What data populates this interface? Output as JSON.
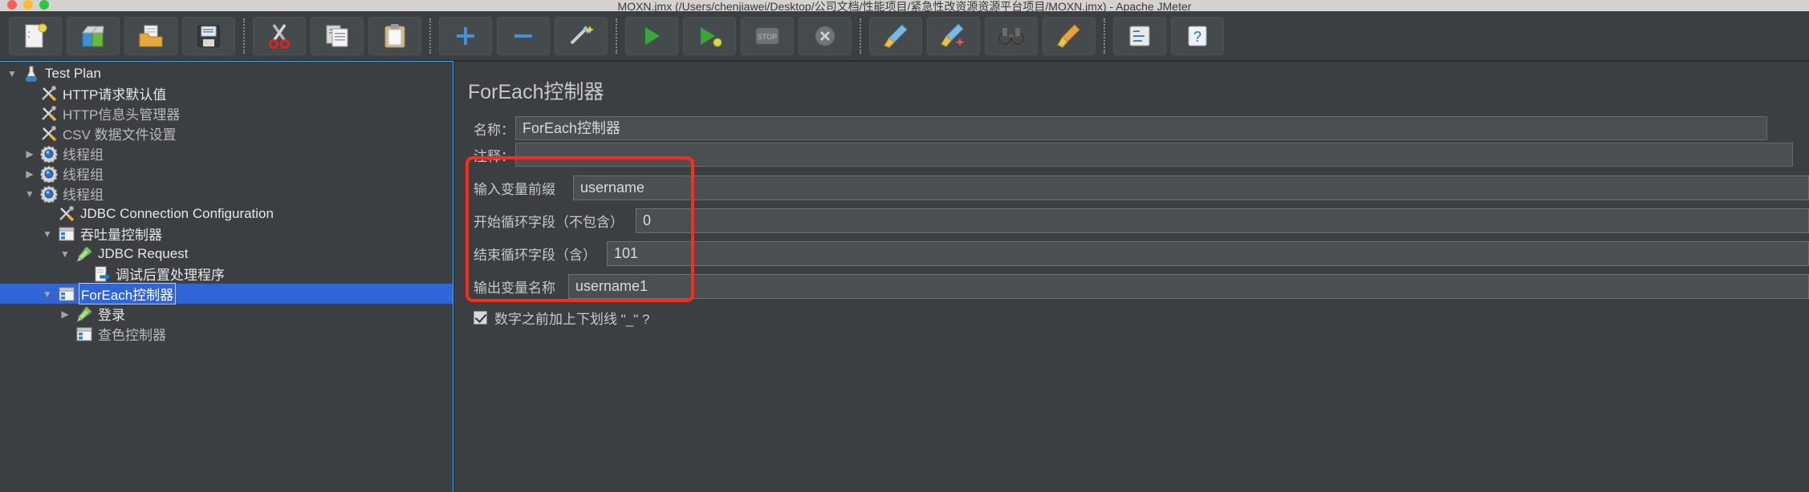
{
  "window": {
    "title": "MOXN.jmx (/Users/chenjiawei/Desktop/公司文档/性能项目/紧急性改资源资源平台项目/MOXN.jmx) - Apache JMeter",
    "traffic_lights": [
      "close",
      "minimize",
      "zoom"
    ]
  },
  "toolbar": {
    "buttons": [
      {
        "name": "new",
        "icon": "new-document-icon",
        "glyph": "📄"
      },
      {
        "name": "templates",
        "icon": "templates-icon",
        "glyph": "📚"
      },
      {
        "name": "open",
        "icon": "open-folder-icon",
        "glyph": "📂"
      },
      {
        "name": "save",
        "icon": "save-disk-icon",
        "glyph": "💾"
      },
      {
        "name": "separator-1",
        "icon": "separator",
        "glyph": ""
      },
      {
        "name": "cut",
        "icon": "scissors-icon",
        "glyph": "✂"
      },
      {
        "name": "copy",
        "icon": "copy-icon",
        "glyph": "📋"
      },
      {
        "name": "paste",
        "icon": "clipboard-icon",
        "glyph": "📋"
      },
      {
        "name": "separator-2",
        "icon": "separator",
        "glyph": ""
      },
      {
        "name": "expand-all",
        "icon": "plus-icon",
        "glyph": "+"
      },
      {
        "name": "collapse-all",
        "icon": "minus-icon",
        "glyph": "−"
      },
      {
        "name": "toggle",
        "icon": "toggle-wand-icon",
        "glyph": "✦"
      },
      {
        "name": "separator-3",
        "icon": "separator",
        "glyph": ""
      },
      {
        "name": "start",
        "icon": "play-icon",
        "glyph": "▶"
      },
      {
        "name": "start-no-pauses",
        "icon": "play-no-pause-icon",
        "glyph": "▶"
      },
      {
        "name": "stop",
        "icon": "stop-icon",
        "glyph": "STOP"
      },
      {
        "name": "shutdown",
        "icon": "shutdown-icon",
        "glyph": "✖"
      },
      {
        "name": "separator-4",
        "icon": "separator",
        "glyph": ""
      },
      {
        "name": "clear",
        "icon": "clear-broom-icon",
        "glyph": "🧹"
      },
      {
        "name": "clear-all",
        "icon": "clear-all-broom-icon",
        "glyph": "🧹"
      },
      {
        "name": "search",
        "icon": "binoculars-icon",
        "glyph": "🔍"
      },
      {
        "name": "reset-search",
        "icon": "reset-search-broom-icon",
        "glyph": "🧹"
      },
      {
        "name": "separator-5",
        "icon": "separator",
        "glyph": ""
      },
      {
        "name": "function-helper",
        "icon": "function-helper-icon",
        "glyph": "≡"
      },
      {
        "name": "help",
        "icon": "help-question-icon",
        "glyph": "?"
      }
    ]
  },
  "tree": {
    "nodes": [
      {
        "label": "Test Plan",
        "indent": 0,
        "twisty": "▼",
        "icon": "flask-icon",
        "dim": false
      },
      {
        "label": "HTTP请求默认值",
        "indent": 1,
        "twisty": "",
        "icon": "config-tools-icon",
        "dim": false
      },
      {
        "label": "HTTP信息头管理器",
        "indent": 1,
        "twisty": "",
        "icon": "config-tools-icon",
        "dim": true
      },
      {
        "label": "CSV 数据文件设置",
        "indent": 1,
        "twisty": "",
        "icon": "config-tools-icon",
        "dim": true
      },
      {
        "label": "线程组",
        "indent": 1,
        "twisty": "▶",
        "icon": "thread-group-icon",
        "dim": true
      },
      {
        "label": "线程组",
        "indent": 1,
        "twisty": "▶",
        "icon": "thread-group-icon",
        "dim": true
      },
      {
        "label": "线程组",
        "indent": 1,
        "twisty": "▼",
        "icon": "thread-group-icon",
        "dim": true
      },
      {
        "label": "JDBC Connection Configuration",
        "indent": 2,
        "twisty": "",
        "icon": "config-tools-icon",
        "dim": false
      },
      {
        "label": "吞吐量控制器",
        "indent": 2,
        "twisty": "▼",
        "icon": "controller-icon",
        "dim": false
      },
      {
        "label": "JDBC Request",
        "indent": 3,
        "twisty": "▼",
        "icon": "sampler-pipette-icon",
        "dim": false
      },
      {
        "label": "调试后置处理程序",
        "indent": 4,
        "twisty": "",
        "icon": "postprocessor-icon",
        "dim": false
      },
      {
        "label": "ForEach控制器",
        "indent": 2,
        "twisty": "▼",
        "icon": "controller-icon",
        "dim": false,
        "selected": true
      },
      {
        "label": "登录",
        "indent": 3,
        "twisty": "▶",
        "icon": "sampler-pipette-icon",
        "dim": false
      },
      {
        "label": "查色控制器",
        "indent": 3,
        "twisty": "",
        "icon": "controller-icon",
        "dim": true
      }
    ]
  },
  "editor": {
    "title": "ForEach控制器",
    "name_label": "名称：",
    "name_value": "ForEach控制器",
    "comment_label": "注释：",
    "comment_value": "",
    "params": [
      {
        "label": "输入变量前缀",
        "value": "username"
      },
      {
        "label": "开始循环字段（不包含）",
        "value": "0"
      },
      {
        "label": "结束循环字段（含）",
        "value": "101"
      },
      {
        "label": "输出变量名称",
        "value": "username1"
      }
    ],
    "checkbox": {
      "label": "数字之前加上下划线 \"_\" ?",
      "checked": true
    }
  },
  "colors": {
    "accent_selection": "#2f65d4",
    "highlight_box": "#fc2b1a",
    "panel_bg": "#3c3f41",
    "field_bg": "#4b4f51",
    "titlebar_bg": "#d6d2d0"
  }
}
